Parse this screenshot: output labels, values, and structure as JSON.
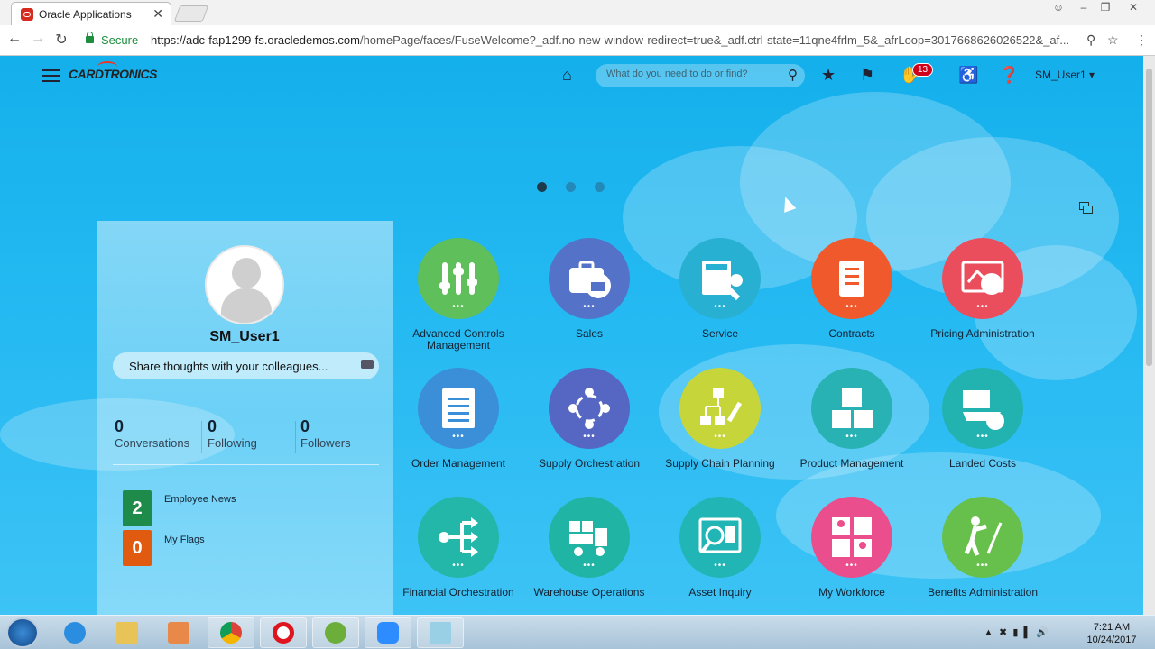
{
  "browser": {
    "tab_title": "Oracle Applications",
    "tab_close": "✕",
    "secure_label": "Secure",
    "url_domain": "https://adc-fap1299-fs.oracledemos.com",
    "url_path": "/homePage/faces/FuseWelcome?_adf.no-new-window-redirect=true&_adf.ctrl-state=11qne4frlm_5&_afrLoop=3017668626026522&_af..."
  },
  "header": {
    "logo": "CARDTRONICS",
    "search_placeholder": "What do you need to do or find?",
    "notification_count": "13",
    "user_menu": "SM_User1 ▾"
  },
  "profile": {
    "username": "SM_User1",
    "share_placeholder": "Share thoughts with your colleagues...",
    "stats": [
      {
        "value": "0",
        "label": "Conversations"
      },
      {
        "value": "0",
        "label": "Following"
      },
      {
        "value": "0",
        "label": "Followers"
      }
    ],
    "tiles": [
      {
        "count": "2",
        "label": "Employee News",
        "color": "#1e8b4a"
      },
      {
        "count": "0",
        "label": "My Flags",
        "color": "#e05a10"
      }
    ]
  },
  "apps": [
    {
      "label": "Advanced Controls Management",
      "color": "#5fbf5b",
      "icon": "sliders-icon"
    },
    {
      "label": "Sales",
      "color": "#5472c8",
      "icon": "briefcase-bank-icon"
    },
    {
      "label": "Service",
      "color": "#27b0d2",
      "icon": "calculator-wrench-icon"
    },
    {
      "label": "Contracts",
      "color": "#f0592b",
      "icon": "scroll-document-icon"
    },
    {
      "label": "Pricing Administration",
      "color": "#ea4e5c",
      "icon": "price-chart-icon"
    },
    {
      "label": "Order Management",
      "color": "#3a8fd8",
      "icon": "document-list-icon"
    },
    {
      "label": "Supply Orchestration",
      "color": "#5567c2",
      "icon": "cycle-icon"
    },
    {
      "label": "Supply Chain Planning",
      "color": "#c6d63a",
      "icon": "hierarchy-pencil-icon"
    },
    {
      "label": "Product Management",
      "color": "#28b2b4",
      "icon": "boxes-icon"
    },
    {
      "label": "Landed Costs",
      "color": "#22b2b0",
      "icon": "ship-cost-icon"
    },
    {
      "label": "Financial Orchestration",
      "color": "#22b7a8",
      "icon": "branch-arrows-icon"
    },
    {
      "label": "Warehouse Operations",
      "color": "#20b4a4",
      "icon": "forklift-icon"
    },
    {
      "label": "Asset Inquiry",
      "color": "#21b6b5",
      "icon": "asset-search-icon"
    },
    {
      "label": "My Workforce",
      "color": "#ea4e8c",
      "icon": "people-grid-icon"
    },
    {
      "label": "Benefits Administration",
      "color": "#67c04b",
      "icon": "golfer-icon"
    }
  ],
  "taskbar": {
    "time": "7:21 AM",
    "date": "10/24/2017"
  }
}
